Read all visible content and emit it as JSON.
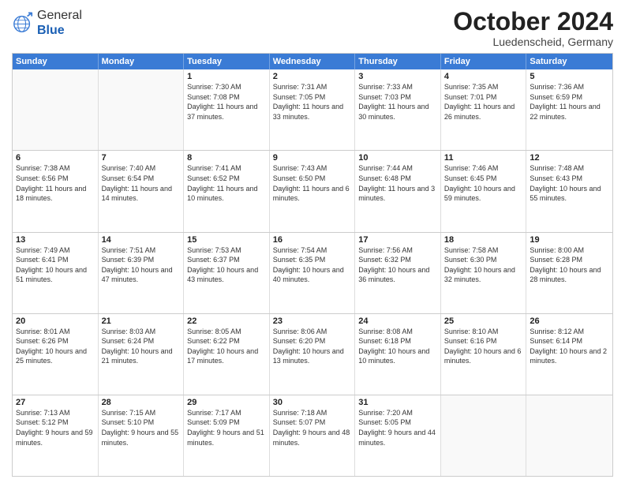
{
  "header": {
    "logo_general": "General",
    "logo_blue": "Blue",
    "month_title": "October 2024",
    "subtitle": "Luedenscheid, Germany"
  },
  "weekdays": [
    "Sunday",
    "Monday",
    "Tuesday",
    "Wednesday",
    "Thursday",
    "Friday",
    "Saturday"
  ],
  "weeks": [
    [
      {
        "day": "",
        "empty": true
      },
      {
        "day": "",
        "empty": true
      },
      {
        "day": "1",
        "sunrise": "7:30 AM",
        "sunset": "7:08 PM",
        "daylight": "11 hours and 37 minutes."
      },
      {
        "day": "2",
        "sunrise": "7:31 AM",
        "sunset": "7:05 PM",
        "daylight": "11 hours and 33 minutes."
      },
      {
        "day": "3",
        "sunrise": "7:33 AM",
        "sunset": "7:03 PM",
        "daylight": "11 hours and 30 minutes."
      },
      {
        "day": "4",
        "sunrise": "7:35 AM",
        "sunset": "7:01 PM",
        "daylight": "11 hours and 26 minutes."
      },
      {
        "day": "5",
        "sunrise": "7:36 AM",
        "sunset": "6:59 PM",
        "daylight": "11 hours and 22 minutes."
      }
    ],
    [
      {
        "day": "6",
        "sunrise": "7:38 AM",
        "sunset": "6:56 PM",
        "daylight": "11 hours and 18 minutes."
      },
      {
        "day": "7",
        "sunrise": "7:40 AM",
        "sunset": "6:54 PM",
        "daylight": "11 hours and 14 minutes."
      },
      {
        "day": "8",
        "sunrise": "7:41 AM",
        "sunset": "6:52 PM",
        "daylight": "11 hours and 10 minutes."
      },
      {
        "day": "9",
        "sunrise": "7:43 AM",
        "sunset": "6:50 PM",
        "daylight": "11 hours and 6 minutes."
      },
      {
        "day": "10",
        "sunrise": "7:44 AM",
        "sunset": "6:48 PM",
        "daylight": "11 hours and 3 minutes."
      },
      {
        "day": "11",
        "sunrise": "7:46 AM",
        "sunset": "6:45 PM",
        "daylight": "10 hours and 59 minutes."
      },
      {
        "day": "12",
        "sunrise": "7:48 AM",
        "sunset": "6:43 PM",
        "daylight": "10 hours and 55 minutes."
      }
    ],
    [
      {
        "day": "13",
        "sunrise": "7:49 AM",
        "sunset": "6:41 PM",
        "daylight": "10 hours and 51 minutes."
      },
      {
        "day": "14",
        "sunrise": "7:51 AM",
        "sunset": "6:39 PM",
        "daylight": "10 hours and 47 minutes."
      },
      {
        "day": "15",
        "sunrise": "7:53 AM",
        "sunset": "6:37 PM",
        "daylight": "10 hours and 43 minutes."
      },
      {
        "day": "16",
        "sunrise": "7:54 AM",
        "sunset": "6:35 PM",
        "daylight": "10 hours and 40 minutes."
      },
      {
        "day": "17",
        "sunrise": "7:56 AM",
        "sunset": "6:32 PM",
        "daylight": "10 hours and 36 minutes."
      },
      {
        "day": "18",
        "sunrise": "7:58 AM",
        "sunset": "6:30 PM",
        "daylight": "10 hours and 32 minutes."
      },
      {
        "day": "19",
        "sunrise": "8:00 AM",
        "sunset": "6:28 PM",
        "daylight": "10 hours and 28 minutes."
      }
    ],
    [
      {
        "day": "20",
        "sunrise": "8:01 AM",
        "sunset": "6:26 PM",
        "daylight": "10 hours and 25 minutes."
      },
      {
        "day": "21",
        "sunrise": "8:03 AM",
        "sunset": "6:24 PM",
        "daylight": "10 hours and 21 minutes."
      },
      {
        "day": "22",
        "sunrise": "8:05 AM",
        "sunset": "6:22 PM",
        "daylight": "10 hours and 17 minutes."
      },
      {
        "day": "23",
        "sunrise": "8:06 AM",
        "sunset": "6:20 PM",
        "daylight": "10 hours and 13 minutes."
      },
      {
        "day": "24",
        "sunrise": "8:08 AM",
        "sunset": "6:18 PM",
        "daylight": "10 hours and 10 minutes."
      },
      {
        "day": "25",
        "sunrise": "8:10 AM",
        "sunset": "6:16 PM",
        "daylight": "10 hours and 6 minutes."
      },
      {
        "day": "26",
        "sunrise": "8:12 AM",
        "sunset": "6:14 PM",
        "daylight": "10 hours and 2 minutes."
      }
    ],
    [
      {
        "day": "27",
        "sunrise": "7:13 AM",
        "sunset": "5:12 PM",
        "daylight": "9 hours and 59 minutes."
      },
      {
        "day": "28",
        "sunrise": "7:15 AM",
        "sunset": "5:10 PM",
        "daylight": "9 hours and 55 minutes."
      },
      {
        "day": "29",
        "sunrise": "7:17 AM",
        "sunset": "5:09 PM",
        "daylight": "9 hours and 51 minutes."
      },
      {
        "day": "30",
        "sunrise": "7:18 AM",
        "sunset": "5:07 PM",
        "daylight": "9 hours and 48 minutes."
      },
      {
        "day": "31",
        "sunrise": "7:20 AM",
        "sunset": "5:05 PM",
        "daylight": "9 hours and 44 minutes."
      },
      {
        "day": "",
        "empty": true
      },
      {
        "day": "",
        "empty": true
      }
    ]
  ],
  "labels": {
    "sunrise": "Sunrise:",
    "sunset": "Sunset:",
    "daylight": "Daylight:"
  }
}
